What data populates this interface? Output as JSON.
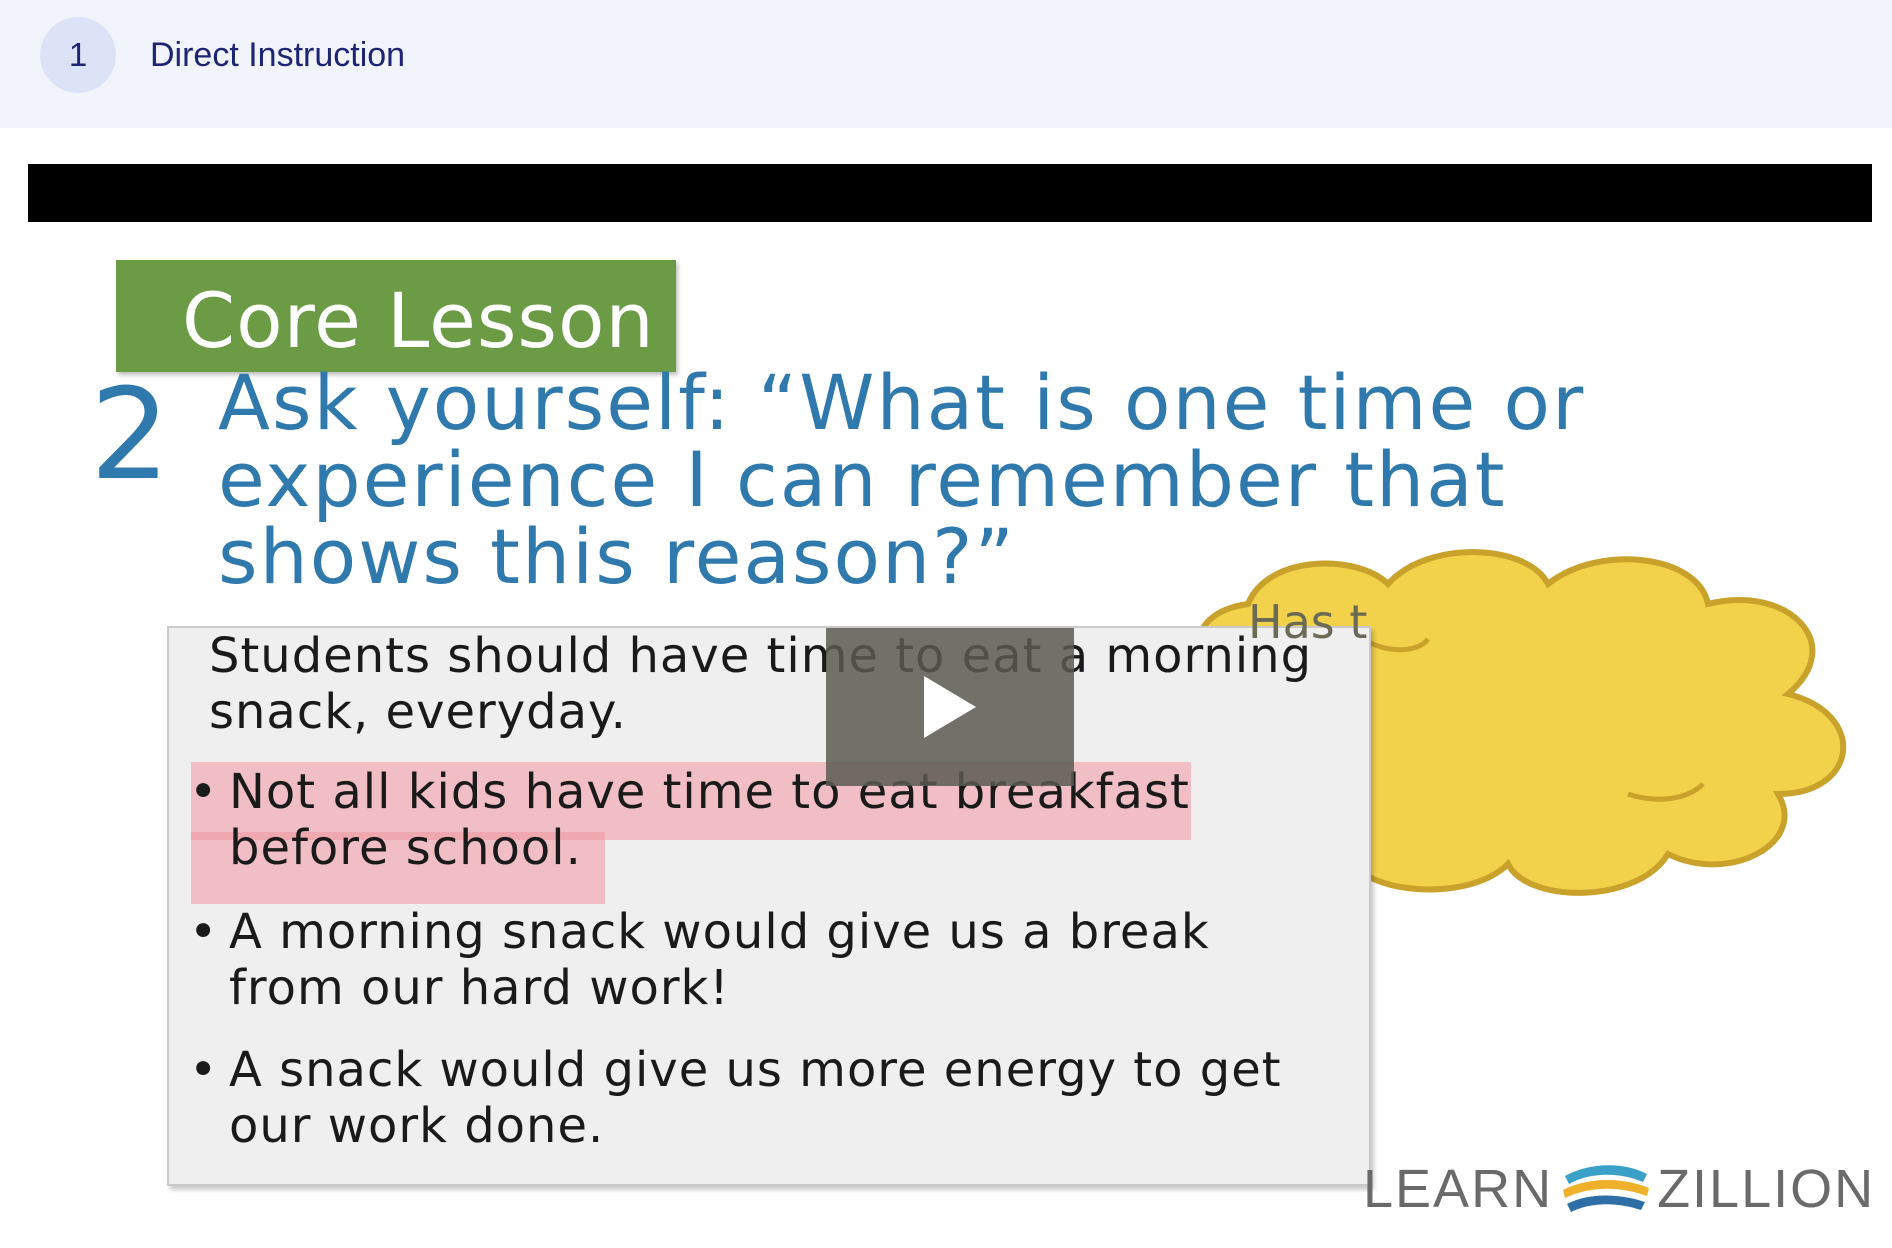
{
  "header": {
    "step_number": "1",
    "step_title": "Direct Instruction"
  },
  "video": {
    "tab_label": "Core Lesson",
    "step_number": "2",
    "prompt": "Ask yourself: “What is one time or experience I can remember that shows this reason?”",
    "claim": "Students should have time to eat a morning snack, everyday.",
    "reasons": [
      "Not all kids have time to eat breakfast before school.",
      "A morning snack would give us a break from our hard work!",
      "A snack would give us more energy to get our work done."
    ],
    "thought_bubble_text": "Has t",
    "logo_left": "LEARN",
    "logo_right": "ZILLION",
    "play_icon": "play-icon",
    "colors": {
      "tab_green": "#6c9b45",
      "prompt_blue": "#2f79ad",
      "cloud_yellow": "#f2d24a",
      "highlight_pink": "#f096a0"
    }
  }
}
